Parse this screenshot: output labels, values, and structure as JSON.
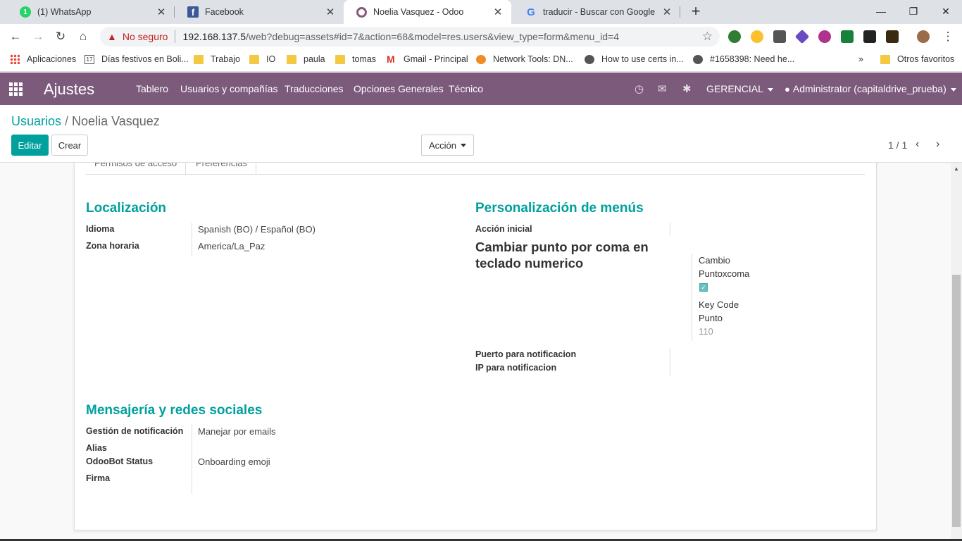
{
  "browser": {
    "tabs": [
      {
        "title": "(1) WhatsApp",
        "icon": "whatsapp-icon"
      },
      {
        "title": "Facebook",
        "icon": "facebook-icon"
      },
      {
        "title": "Noelia Vasquez - Odoo",
        "icon": "odoo-icon",
        "active": true
      },
      {
        "title": "traducir - Buscar con Google",
        "icon": "google-icon"
      }
    ],
    "whatsapp_badge": "1",
    "new_tab": "+",
    "address": {
      "security_label": "No seguro",
      "host": "192.168.137.5",
      "path": "/web?debug=assets#id=7&action=68&model=res.users&view_type=form&menu_id=4"
    },
    "bookmarks": [
      {
        "label": "Aplicaciones",
        "icon": "apps-icon"
      },
      {
        "label": "Días festivos en Boli...",
        "icon": "calendar-icon"
      },
      {
        "label": "Trabajo",
        "icon": "folder-icon"
      },
      {
        "label": "IO",
        "icon": "folder-icon"
      },
      {
        "label": "paula",
        "icon": "folder-icon"
      },
      {
        "label": "tomas",
        "icon": "folder-icon"
      },
      {
        "label": "Gmail - Principal",
        "icon": "gmail-icon"
      },
      {
        "label": "Network Tools: DN...",
        "icon": "network-tools-icon"
      },
      {
        "label": "How to use certs in...",
        "icon": "globe-icon"
      },
      {
        "label": "#1658398: Need he...",
        "icon": "globe-icon"
      }
    ],
    "more_bookmarks": "»",
    "other_bookmarks": "Otros favoritos",
    "calendar_day": "17"
  },
  "odoo": {
    "brand": "Ajustes",
    "menu": [
      "Tablero",
      "Usuarios y compañías",
      "Traducciones",
      "Opciones Generales",
      "Técnico"
    ],
    "company": "GERENCIAL",
    "user": "Administrator (capitaldrive_prueba)",
    "breadcrumb": {
      "parent": "Usuarios",
      "separator": "/",
      "current": "Noelia Vasquez"
    },
    "buttons": {
      "edit": "Editar",
      "create": "Crear",
      "action": "Acción"
    },
    "pager": "1 / 1"
  },
  "form": {
    "tabs": [
      "Permisos de acceso",
      "Preferencias"
    ],
    "localization": {
      "title": "Localización",
      "language_label": "Idioma",
      "language_value": "Spanish (BO) / Español (BO)",
      "timezone_label": "Zona horaria",
      "timezone_value": "America/La_Paz"
    },
    "menu_custom": {
      "title": "Personalización de menús",
      "initial_action_label": "Acción inicial",
      "heading": "Cambiar punto por coma en teclado numerico",
      "cambio_label_1": "Cambio",
      "cambio_label_2": "Puntoxcoma",
      "checkbox_checked": true,
      "keycode_label_1": "Key Code",
      "keycode_label_2": "Punto",
      "keycode_value": "110",
      "notif_port_label": "Puerto para notificacion",
      "notif_ip_label": "IP para notificacion"
    },
    "messaging": {
      "title": "Mensajería y redes sociales",
      "notif_label": "Gestión de notificación",
      "notif_value": "Manejar por emails",
      "alias_label": "Alias",
      "odoobot_label": "OdooBot Status",
      "odoobot_value": "Onboarding emoji",
      "signature_label": "Firma"
    }
  },
  "colors": {
    "odoo_primary": "#7c5a7c",
    "teal": "#00a09d",
    "warning": "#c5221f"
  }
}
